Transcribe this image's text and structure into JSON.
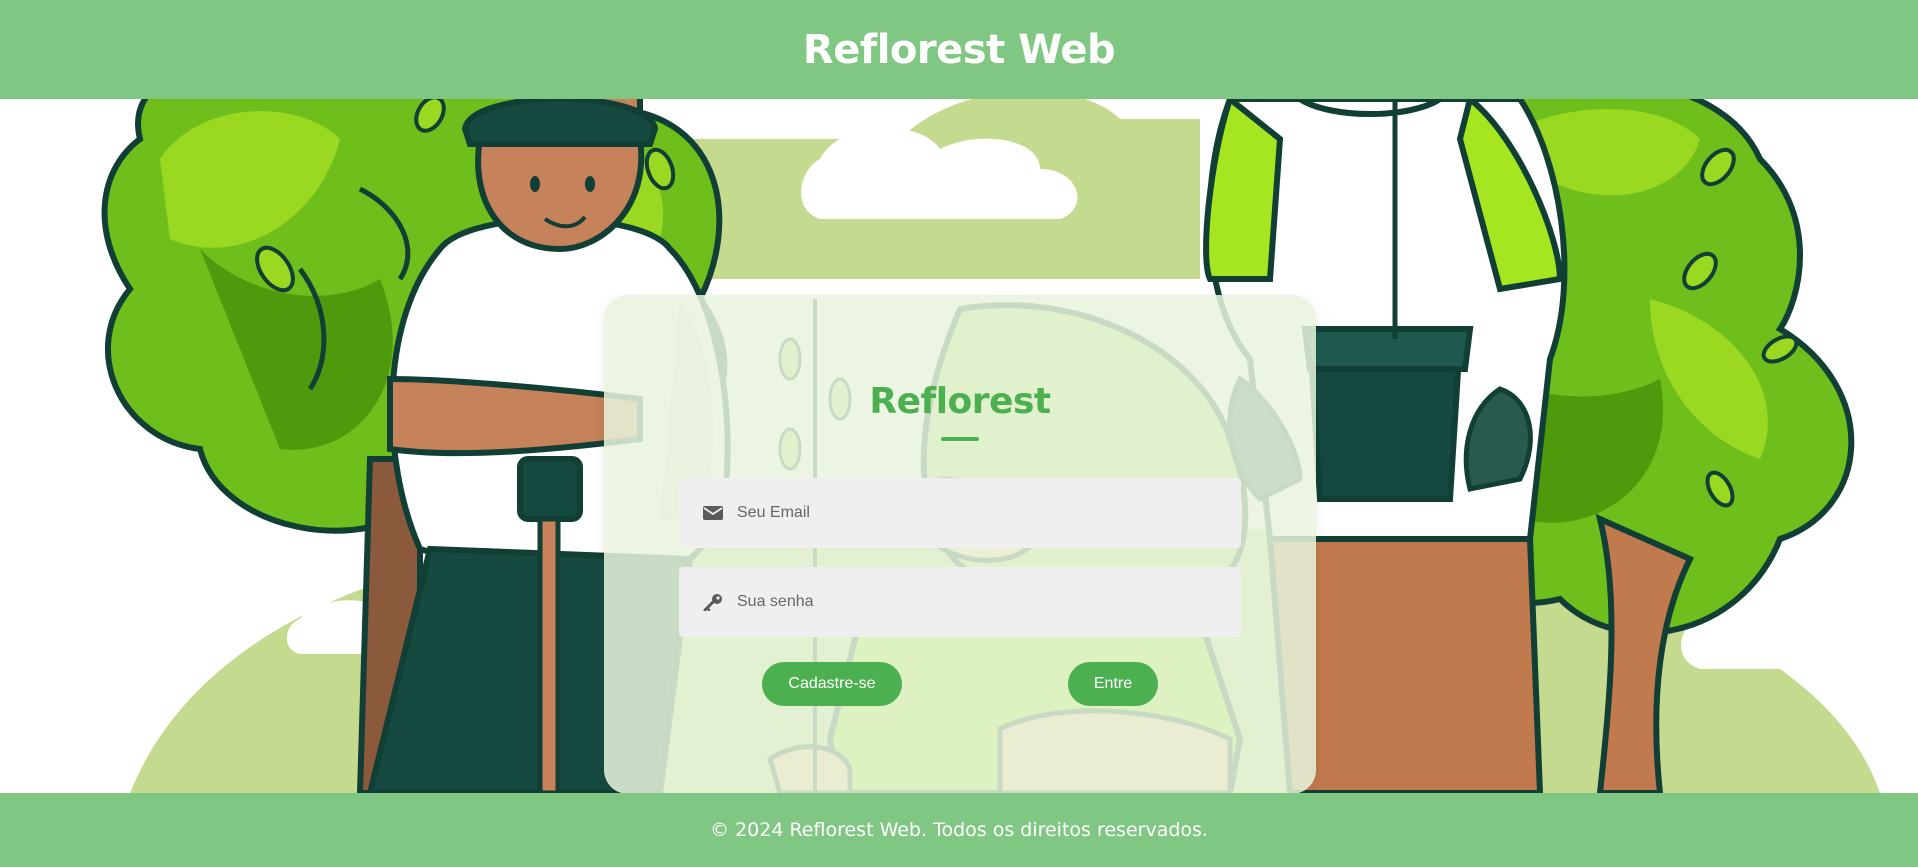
{
  "header": {
    "title": "Reflorest Web"
  },
  "login_card": {
    "title": "Reflorest",
    "email_field": {
      "placeholder": "Seu Email",
      "value": "",
      "icon": "envelope-icon"
    },
    "password_field": {
      "placeholder": "Sua senha",
      "value": "",
      "icon": "key-icon"
    },
    "signup_label": "Cadastre-se",
    "login_label": "Entre"
  },
  "footer": {
    "copyright": "© 2024 Reflorest Web. Todos os direitos reservados."
  },
  "colors": {
    "header_bg": "#81c784",
    "accent": "#4caf50",
    "footer_bg": "#81c784",
    "field_bg": "#efefef"
  }
}
